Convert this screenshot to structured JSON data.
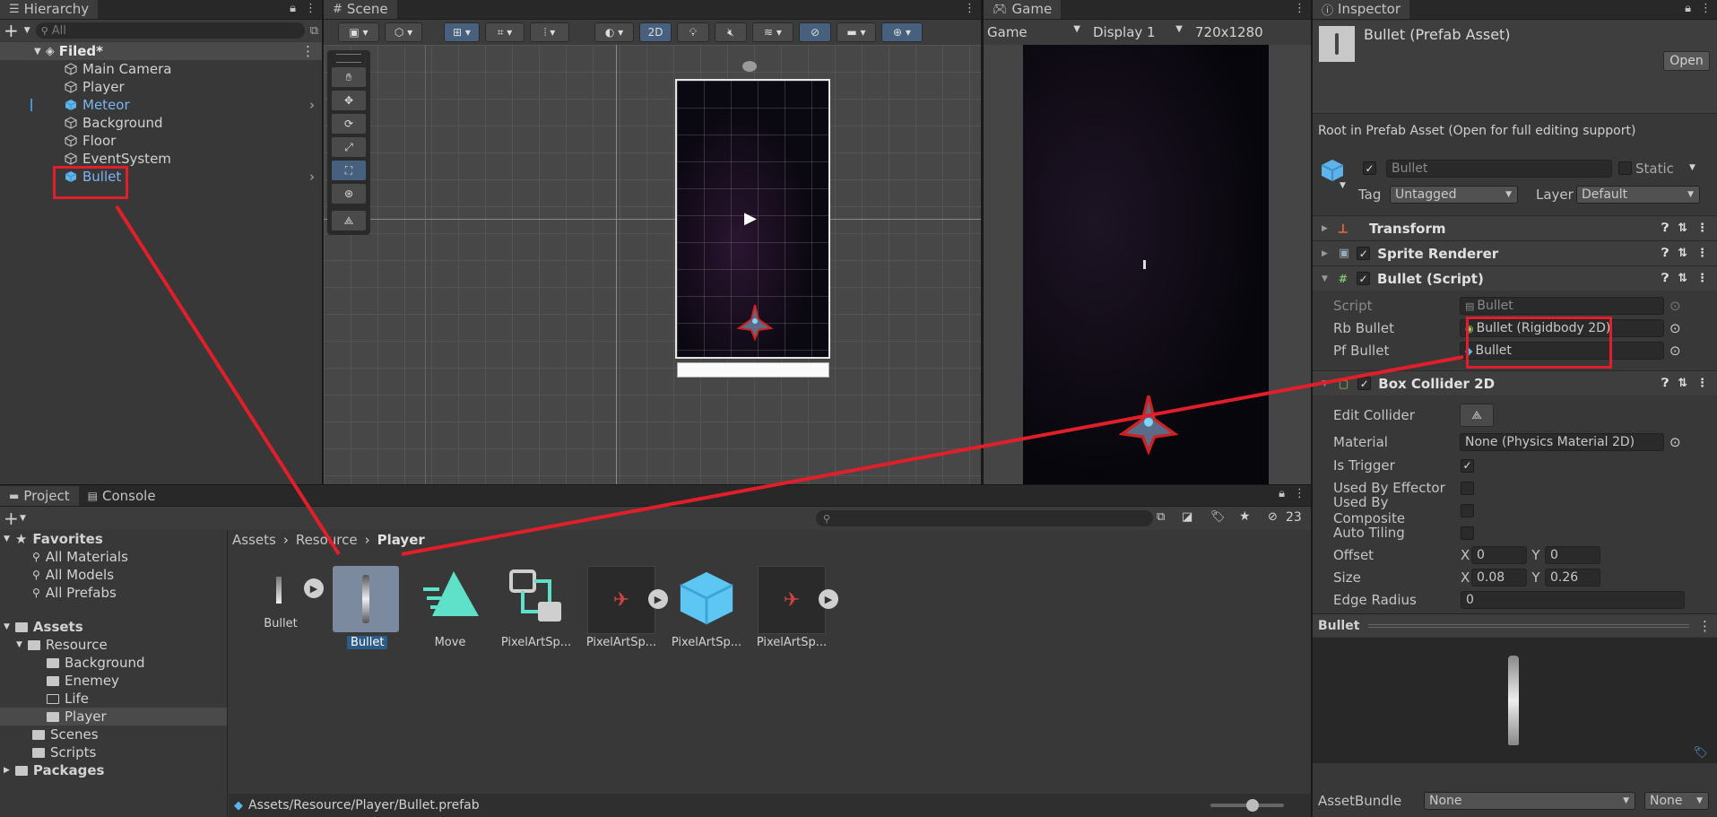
{
  "hierarchy": {
    "tab": "Hierarchy",
    "search_placeholder": "All",
    "scene": "Filed*",
    "items": [
      "Main Camera",
      "Player",
      "Meteor",
      "Background",
      "Floor",
      "EventSystem",
      "Bullet"
    ]
  },
  "scene": {
    "tab": "Scene",
    "toolbar_2d": "2D"
  },
  "game": {
    "tab": "Game",
    "mode": "Game",
    "display": "Display 1",
    "resolution": "720x1280"
  },
  "inspector": {
    "tab": "Inspector",
    "title": "Bullet (Prefab Asset)",
    "open_button": "Open",
    "root_note": "Root in Prefab Asset (Open for full editing support)",
    "name_field": "Bullet",
    "static_label": "Static",
    "tag_label": "Tag",
    "tag_value": "Untagged",
    "layer_label": "Layer",
    "layer_value": "Default",
    "components": {
      "transform": "Transform",
      "sprite_renderer": "Sprite Renderer",
      "bullet_script": "Bullet (Script)",
      "box_collider": "Box Collider 2D"
    },
    "script_fields": {
      "script_label": "Script",
      "script_value": "Bullet",
      "rb_label": "Rb Bullet",
      "rb_value": "Bullet (Rigidbody 2D)",
      "pf_label": "Pf Bullet",
      "pf_value": "Bullet"
    },
    "collider_fields": {
      "edit_collider": "Edit Collider",
      "material_label": "Material",
      "material_value": "None (Physics Material 2D)",
      "is_trigger": "Is Trigger",
      "used_by_effector": "Used By Effector",
      "used_by_composite": "Used By Composite",
      "auto_tiling": "Auto Tiling",
      "offset_label": "Offset",
      "offset_x": "0",
      "offset_y": "0",
      "size_label": "Size",
      "size_x": "0.08",
      "size_y": "0.26",
      "edge_radius_label": "Edge Radius",
      "edge_radius_value": "0",
      "x": "X",
      "y": "Y"
    },
    "preview_title": "Bullet",
    "assetbundle_label": "AssetBundle",
    "assetbundle_value": "None",
    "assetbundle_variant": "None"
  },
  "project": {
    "tab_project": "Project",
    "tab_console": "Console",
    "hidden_count": "23",
    "favorites": {
      "title": "Favorites",
      "items": [
        "All Materials",
        "All Models",
        "All Prefabs"
      ]
    },
    "assets_title": "Assets",
    "resource": "Resource",
    "resource_children": [
      "Background",
      "Enemey",
      "Life",
      "Player"
    ],
    "scenes": "Scenes",
    "scripts": "Scripts",
    "packages": "Packages",
    "breadcrumb": [
      "Assets",
      "Resource",
      "Player"
    ],
    "assets": [
      "Bullet",
      "Bullet",
      "Move",
      "PixelArtSp...",
      "PixelArtSp...",
      "PixelArtSp...",
      "PixelArtSp..."
    ],
    "status_path": "Assets/Resource/Player/Bullet.prefab"
  }
}
